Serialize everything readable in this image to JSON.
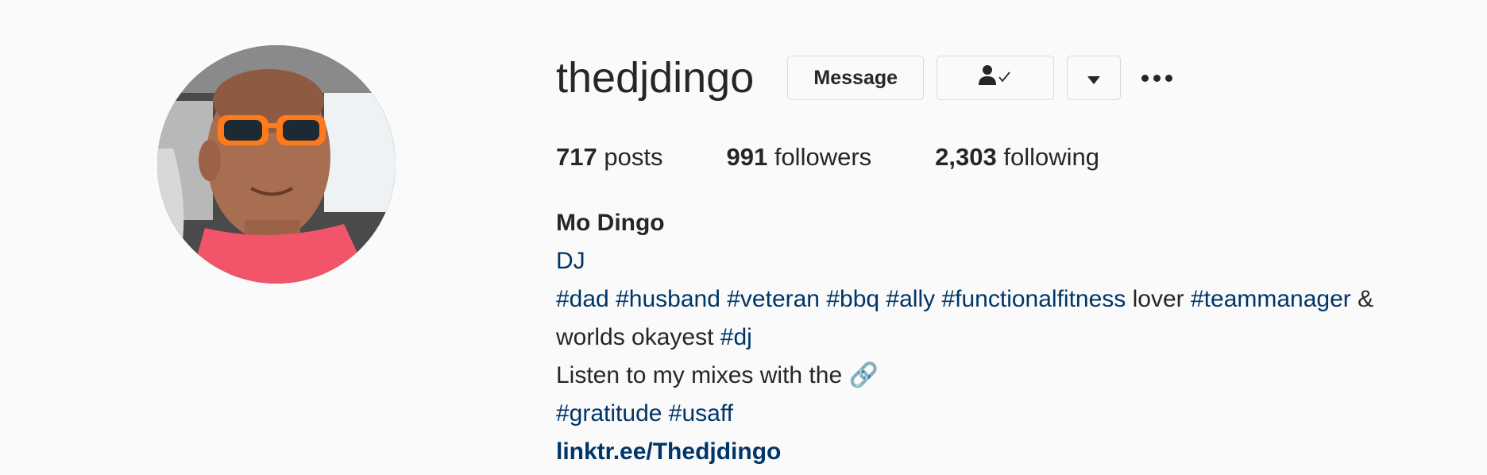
{
  "profile": {
    "username": "thedjdingo",
    "buttons": {
      "message": "Message",
      "following_icon": "person-check-icon",
      "dropdown_icon": "caret-down-icon",
      "more_icon": "more-options-icon"
    },
    "stats": {
      "posts_count": "717",
      "posts_label": "posts",
      "followers_count": "991",
      "followers_label": "followers",
      "following_count": "2,303",
      "following_label": "following"
    },
    "bio": {
      "full_name": "Mo Dingo",
      "category": "DJ",
      "line1": {
        "t1": "#dad",
        "t2": "#husband",
        "t3": "#veteran",
        "t4": "#bbq",
        "t5": "#ally",
        "t6": "#functionalfitness",
        "p1": "lover",
        "t7": "#teammanager",
        "p2": "&"
      },
      "line2": {
        "p1": "worlds okayest",
        "t1": "#dj"
      },
      "line3": {
        "text": "Listen to my mixes with the",
        "emoji": "🔗"
      },
      "line4": {
        "t1": "#gratitude",
        "t2": "#usaff"
      },
      "link": "linktr.ee/Thedjdingo"
    }
  },
  "colors": {
    "background": "#fafafa",
    "text": "#262626",
    "link": "#003569",
    "border": "#dbdbdb"
  }
}
